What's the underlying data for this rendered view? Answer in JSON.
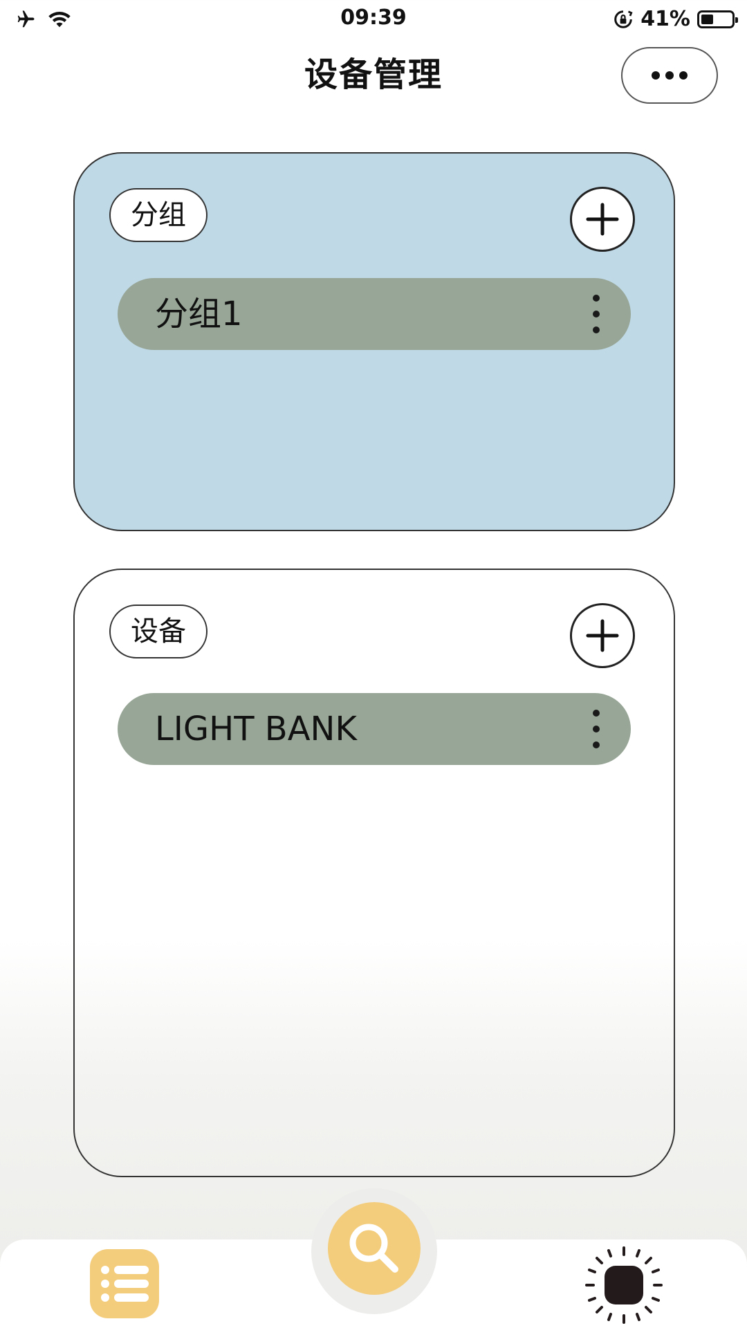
{
  "status_bar": {
    "time": "09:39",
    "battery_percent": "41%",
    "battery_level": 0.41,
    "icons": [
      "airplane-icon",
      "wifi-icon",
      "rotation-lock-icon",
      "battery-icon"
    ]
  },
  "header": {
    "title": "设备管理",
    "more_icon": "more-dots-icon"
  },
  "groups_panel": {
    "label": "分组",
    "add_icon": "plus-icon",
    "background": "#bfd9e7",
    "items": [
      {
        "label": "分组1",
        "menu_icon": "kebab-menu-icon"
      }
    ]
  },
  "devices_panel": {
    "label": "设备",
    "add_icon": "plus-icon",
    "items": [
      {
        "label": "LIGHT BANK",
        "menu_icon": "kebab-menu-icon"
      }
    ]
  },
  "bottom_bar": {
    "tabs": [
      {
        "icon": "list-icon",
        "selected": true
      },
      {
        "icon": "search-icon"
      },
      {
        "icon": "light-icon"
      }
    ]
  },
  "colors": {
    "accent": "#f3cc7c",
    "item_bg": "#97a696",
    "group_panel_bg": "#bfd9e7"
  }
}
